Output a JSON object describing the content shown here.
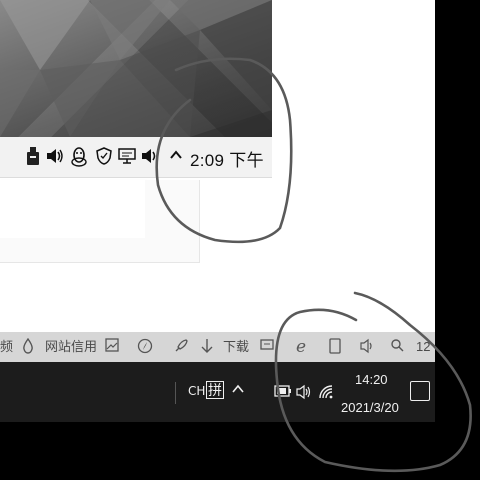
{
  "top_tray": {
    "clock": "2:09 下午",
    "icons": [
      "usb-drive-icon",
      "volume-icon",
      "penguin-qq-icon",
      "shield-icon",
      "network-monitor-icon",
      "volume-icon",
      "chevron-up-icon"
    ]
  },
  "quickbar": {
    "items": [
      {
        "icon": "",
        "label": "频"
      },
      {
        "icon": "droplet-icon",
        "label": ""
      },
      {
        "icon": "",
        "label": "网站信用"
      },
      {
        "icon": "image-icon",
        "label": ""
      },
      {
        "icon": "compass-icon",
        "label": ""
      },
      {
        "icon": "rocket-icon",
        "label": ""
      },
      {
        "icon": "download-arrow-icon",
        "label": "下载"
      },
      {
        "icon": "flag-icon",
        "label": ""
      },
      {
        "icon": "ie-icon",
        "label": ""
      },
      {
        "icon": "phone-icon",
        "label": ""
      },
      {
        "icon": "volume-icon",
        "label": ""
      },
      {
        "icon": "search-icon",
        "label": ""
      },
      {
        "icon": "",
        "label": "12"
      }
    ]
  },
  "taskbar": {
    "ime_mode": "CH",
    "ime_label": "拼",
    "chevron": "^",
    "time": "14:20",
    "date": "2021/3/20"
  }
}
